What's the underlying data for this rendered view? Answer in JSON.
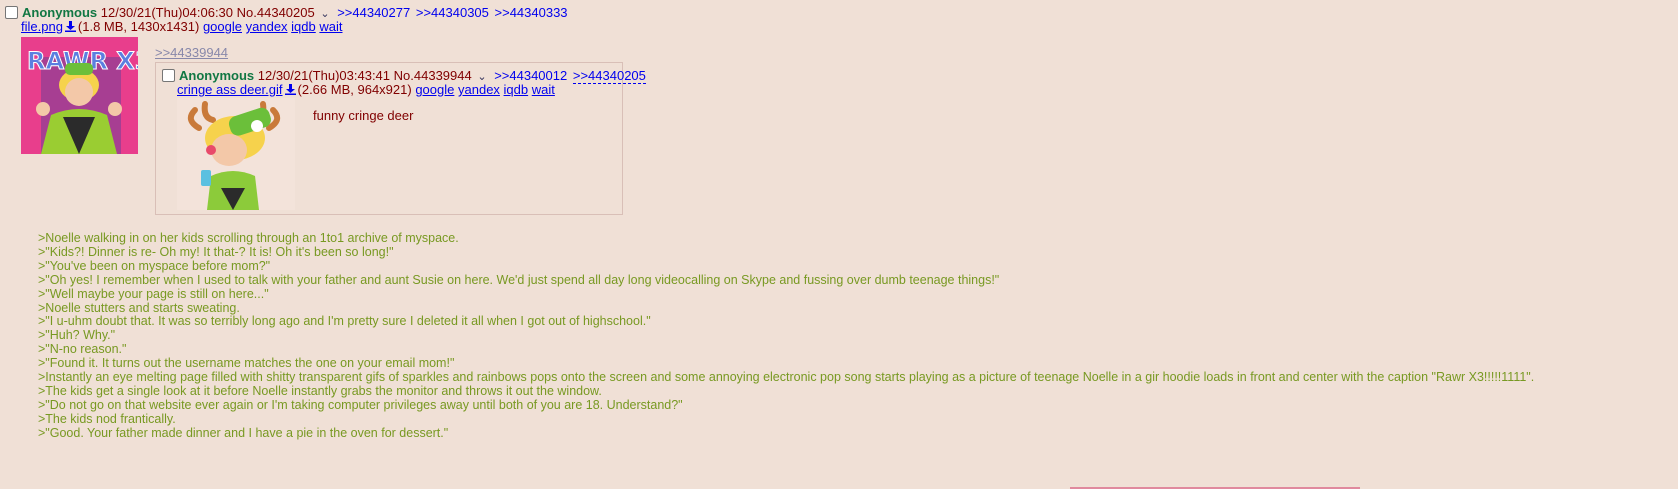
{
  "post": {
    "name": "Anonymous",
    "datetime": "12/30/21(Thu)04:06:30",
    "number": "No.44340205",
    "menu_arrow": "⌄",
    "replies": [
      ">>44340277",
      ">>44340305",
      ">>44340333"
    ],
    "file": {
      "name": "file.png",
      "meta": "(1.8 MB, 1430x1431)",
      "links": [
        "google",
        "yandex",
        "iqdb",
        "wait"
      ],
      "thumb_text": "RAWR X3"
    },
    "quotelink": ">>44339944",
    "inline": {
      "name": "Anonymous",
      "datetime": "12/30/21(Thu)03:43:41",
      "number": "No.44339944",
      "menu_arrow": "⌄",
      "replies": [
        ">>44340012",
        ">>44340205"
      ],
      "file": {
        "name": "cringe ass deer.gif",
        "meta": "(2.66 MB, 964x921)",
        "links": [
          "google",
          "yandex",
          "iqdb",
          "wait"
        ]
      },
      "body": "funny cringe deer"
    },
    "lines": [
      ">Noelle walking in on her kids scrolling through an 1to1 archive of myspace.",
      ">\"Kids?! Dinner is re- Oh my! It that-? It is! Oh it's been so long!\"",
      ">\"You've been on myspace before mom?\"",
      ">\"Oh yes! I remember when I used to talk with your father and aunt Susie on here. We'd just spend all day long videocalling on Skype and fussing over dumb teenage things!\"",
      ">\"Well maybe your page is still on here...\"",
      ">Noelle stutters and starts sweating.",
      ">\"I u-uhm doubt that. It was so terribly long ago and I'm pretty sure I deleted it all when I got out of highschool.\"",
      ">\"Huh? Why.\"",
      ">\"N-no reason.\"",
      ">\"Found it. It turns out the username matches the one on your email mom!\"",
      ">Instantly an eye melting page filled with shitty transparent gifs of sparkles and rainbows pops onto the screen and some annoying electronic pop song starts playing as a picture of teenage Noelle in a gir hoodie loads in front and center with the caption \"Rawr X3!!!!!1111\".",
      ">The kids get a single look at it before Noelle instantly grabs the monitor and throws it out the window.",
      ">\"Do not go on that website ever again or I'm taking computer privileges away until both of you are 18. Understand?\"",
      ">The kids nod frantically.",
      ">\"Good. Your father made dinner and I have a pie in the oven for dessert.\""
    ]
  },
  "colors": {
    "background": "#F0E0D6",
    "name": "#117743",
    "greentext": "#789922",
    "link": "#0000EE",
    "text": "#800000"
  },
  "icons": [
    "download-icon",
    "chevron-down-icon",
    "checkbox"
  ]
}
